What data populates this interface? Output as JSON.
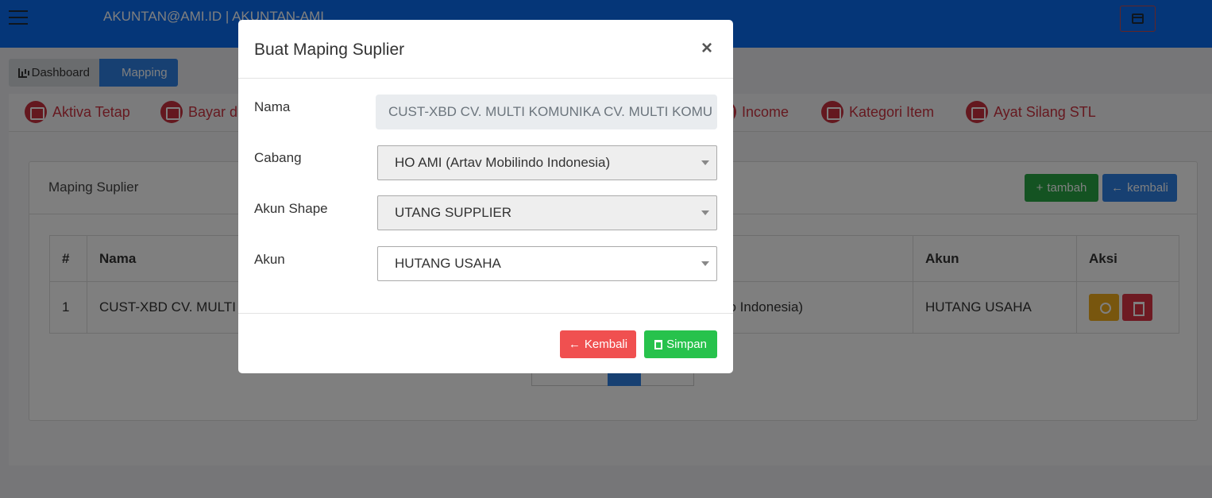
{
  "header": {
    "user": "AKUNTAN@AMI.ID | AKUNTAN-AMI",
    "menu_icon": "hamburger-icon",
    "window_icon": "window-icon"
  },
  "breadcrumb": {
    "dashboard": "Dashboard",
    "mapping": "Mapping"
  },
  "menu": [
    {
      "label": "Aktiva Tetap",
      "icon": "chart-icon"
    },
    {
      "label": "Bayar di",
      "icon": "window-icon"
    },
    {
      "label": "Income",
      "icon": "window-icon"
    },
    {
      "label": "Kategori Item",
      "icon": "checkbox-icon"
    },
    {
      "label": "Ayat Silang STL",
      "icon": "window-icon"
    }
  ],
  "card": {
    "title": "Maping Suplier",
    "add_label": "tambah",
    "back_label": "kembali"
  },
  "table": {
    "headers": [
      "#",
      "Nama",
      "Akun",
      "Aksi"
    ],
    "rows": [
      {
        "no": "1",
        "nama": "CUST-XBD CV. MULTI K",
        "cabang_tail": "o Indonesia)",
        "akun": "HUTANG USAHA"
      }
    ]
  },
  "modal": {
    "title": "Buat Maping Suplier",
    "close": "×",
    "fields": {
      "nama": {
        "label": "Nama",
        "value": "CUST-XBD  CV. MULTI KOMUNIKA CV. MULTI KOMU"
      },
      "cabang": {
        "label": "Cabang",
        "value": "HO AMI (Artav Mobilindo Indonesia)"
      },
      "akun_shape": {
        "label": "Akun Shape",
        "value": "UTANG SUPPLIER"
      },
      "akun": {
        "label": "Akun",
        "value": "HUTANG USAHA"
      }
    },
    "back_label": "Kembali",
    "save_label": "Simpan"
  },
  "colors": {
    "primary": "#2f80e4",
    "success": "#27c24c",
    "danger": "#f05050",
    "menu_red": "#cc3341"
  }
}
